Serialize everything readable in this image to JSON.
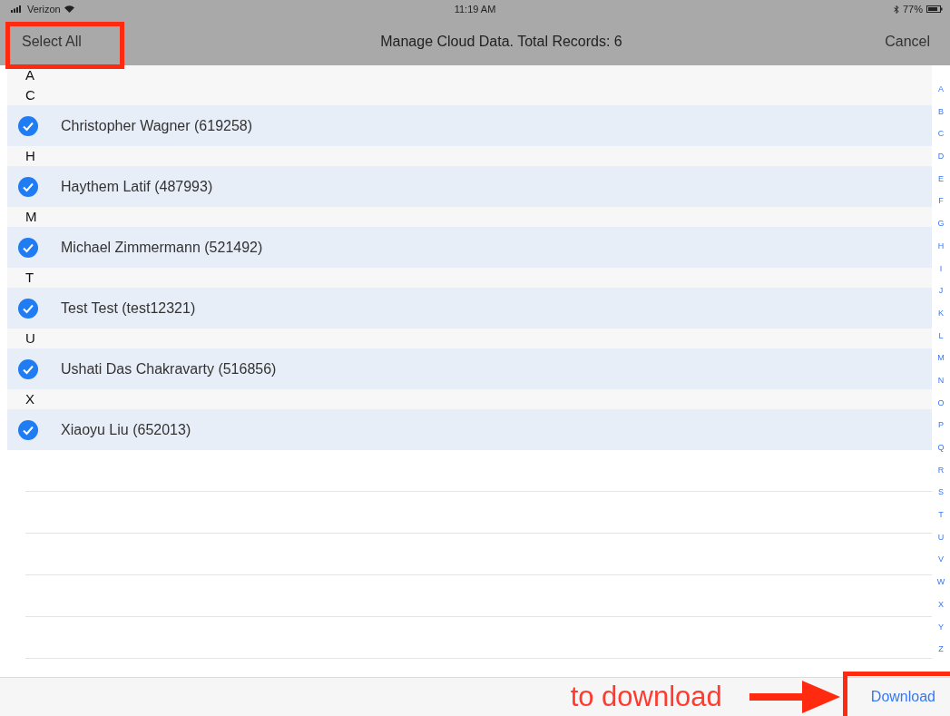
{
  "status_bar": {
    "carrier": "Verizon",
    "time": "11:19 AM",
    "battery": "77%"
  },
  "nav_bar": {
    "left_button": "Select All",
    "title": "Manage Cloud Data. Total Records: 6",
    "right_button": "Cancel"
  },
  "sections": [
    {
      "letter": "A"
    },
    {
      "letter": "C",
      "rows": [
        {
          "name": "Christopher Wagner (619258)",
          "checked": true
        }
      ]
    },
    {
      "letter": "H",
      "rows": [
        {
          "name": "Haythem Latif (487993)",
          "checked": true
        }
      ]
    },
    {
      "letter": "M",
      "rows": [
        {
          "name": "Michael Zimmermann (521492)",
          "checked": true
        }
      ]
    },
    {
      "letter": "T",
      "rows": [
        {
          "name": "Test Test (test12321)",
          "checked": true
        }
      ]
    },
    {
      "letter": "U",
      "rows": [
        {
          "name": "Ushati Das Chakravarty (516856)",
          "checked": true
        }
      ]
    },
    {
      "letter": "X",
      "rows": [
        {
          "name": "Xiaoyu Liu (652013)",
          "checked": true
        }
      ]
    }
  ],
  "section_index": [
    "A",
    "B",
    "C",
    "D",
    "E",
    "F",
    "G",
    "H",
    "I",
    "J",
    "K",
    "L",
    "M",
    "N",
    "O",
    "P",
    "Q",
    "R",
    "S",
    "T",
    "U",
    "V",
    "W",
    "X",
    "Y",
    "Z"
  ],
  "toolbar": {
    "button": "Download"
  },
  "annotation": {
    "label": "to download"
  }
}
